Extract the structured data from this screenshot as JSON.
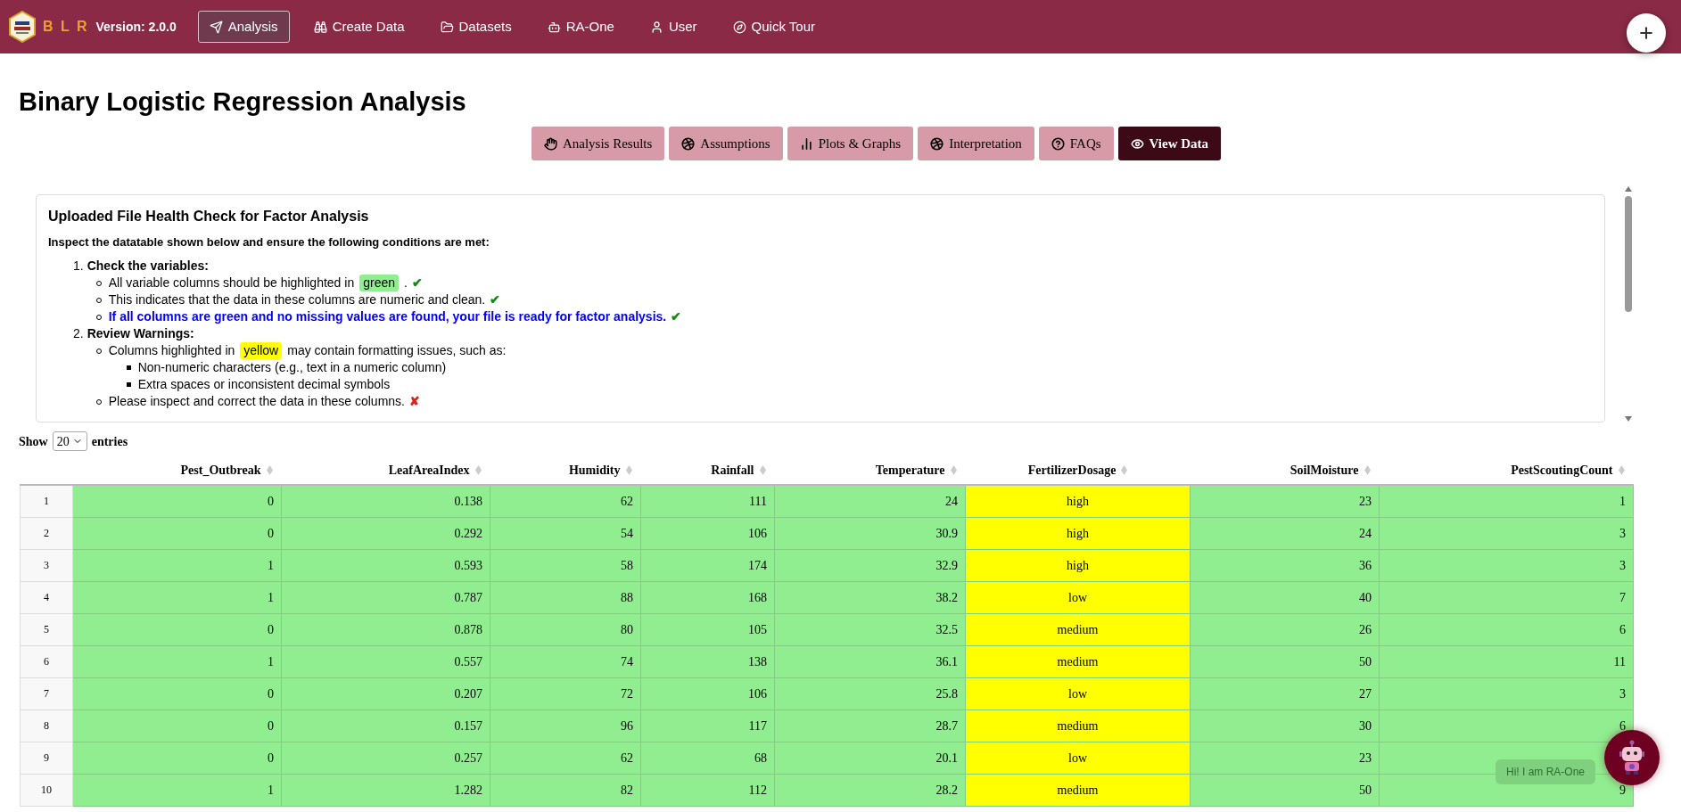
{
  "navbar": {
    "brand": "B L R",
    "version": "Version: 2.0.0",
    "items": [
      {
        "label": "Analysis",
        "selected": true
      },
      {
        "label": "Create Data",
        "selected": false
      },
      {
        "label": "Datasets",
        "selected": false
      },
      {
        "label": "RA-One",
        "selected": false
      },
      {
        "label": "User",
        "selected": false
      },
      {
        "label": "Quick Tour",
        "selected": false
      }
    ]
  },
  "page_title": "Binary Logistic Regression Analysis",
  "tabs": [
    {
      "label": "Analysis Results",
      "selected": false
    },
    {
      "label": "Assumptions",
      "selected": false
    },
    {
      "label": "Plots & Graphs",
      "selected": false
    },
    {
      "label": "Interpretation",
      "selected": false
    },
    {
      "label": "FAQs",
      "selected": false
    },
    {
      "label": "View Data",
      "selected": true
    }
  ],
  "health_check": {
    "title": "Uploaded File Health Check for Factor Analysis",
    "intro": "Inspect the datatable shown below and ensure the following conditions are met:",
    "steps": [
      {
        "number": "1.",
        "heading": "Check the variables:",
        "items": [
          {
            "text": "All variable columns should be highlighted in",
            "highlight": {
              "text": "green",
              "color": "#90ee90"
            },
            "after": ".",
            "mark": "✔",
            "kind": "ok",
            "emphasis": false
          },
          {
            "text": "This indicates that the data in these columns are numeric and clean.",
            "mark": "✔",
            "kind": "ok",
            "emphasis": false
          },
          {
            "text": "If all columns are green and no missing values are found, your file is ready for factor analysis.",
            "mark": "✔",
            "kind": "ok",
            "emphasis": true
          }
        ]
      },
      {
        "number": "2.",
        "heading": "Review Warnings:",
        "items": [
          {
            "text": "Columns highlighted in",
            "highlight": {
              "text": "yellow",
              "color": "#ffff00"
            },
            "after": "may contain formatting issues, such as:",
            "emphasis": false,
            "subitems": [
              "Non-numeric characters (e.g., text in a numeric column)",
              "Extra spaces or inconsistent decimal symbols"
            ]
          },
          {
            "text": "Please inspect and correct the data in these columns.",
            "mark": "✘",
            "kind": "error",
            "emphasis": false
          }
        ]
      }
    ]
  },
  "table_controls": {
    "show": "Show",
    "page_size": "20",
    "entries": "entries"
  },
  "table": {
    "columns": [
      {
        "label": "Pest_Outbreak",
        "color": "#90ee90",
        "kind": "numeric"
      },
      {
        "label": "LeafAreaIndex",
        "color": "#90ee90",
        "kind": "numeric"
      },
      {
        "label": "Humidity",
        "color": "#90ee90",
        "kind": "numeric"
      },
      {
        "label": "Rainfall",
        "color": "#90ee90",
        "kind": "numeric"
      },
      {
        "label": "Temperature",
        "color": "#90ee90",
        "kind": "numeric"
      },
      {
        "label": "FertilizerDosage",
        "color": "#ffff00",
        "kind": "text"
      },
      {
        "label": "SoilMoisture",
        "color": "#90ee90",
        "kind": "numeric"
      },
      {
        "label": "PestScoutingCount",
        "color": "#90ee90",
        "kind": "numeric"
      }
    ],
    "rows": [
      {
        "index": "1",
        "cells": [
          "0",
          "0.138",
          "62",
          "111",
          "24",
          "high",
          "23",
          "1"
        ]
      },
      {
        "index": "2",
        "cells": [
          "0",
          "0.292",
          "54",
          "106",
          "30.9",
          "high",
          "24",
          "3"
        ]
      },
      {
        "index": "3",
        "cells": [
          "1",
          "0.593",
          "58",
          "174",
          "32.9",
          "high",
          "36",
          "3"
        ]
      },
      {
        "index": "4",
        "cells": [
          "1",
          "0.787",
          "88",
          "168",
          "38.2",
          "low",
          "40",
          "7"
        ]
      },
      {
        "index": "5",
        "cells": [
          "0",
          "0.878",
          "80",
          "105",
          "32.5",
          "medium",
          "26",
          "6"
        ]
      },
      {
        "index": "6",
        "cells": [
          "1",
          "0.557",
          "74",
          "138",
          "36.1",
          "medium",
          "50",
          "11"
        ]
      },
      {
        "index": "7",
        "cells": [
          "0",
          "0.207",
          "72",
          "106",
          "25.8",
          "low",
          "27",
          "3"
        ]
      },
      {
        "index": "8",
        "cells": [
          "0",
          "0.157",
          "96",
          "117",
          "28.7",
          "medium",
          "30",
          "6"
        ]
      },
      {
        "index": "9",
        "cells": [
          "0",
          "0.257",
          "62",
          "68",
          "20.1",
          "low",
          "23"
        ]
      },
      {
        "index": "10",
        "cells": [
          "1",
          "1.282",
          "82",
          "112",
          "28.2",
          "medium",
          "50",
          "9"
        ]
      }
    ]
  },
  "chat": {
    "tooltip": "Hi! I am RA-One"
  }
}
